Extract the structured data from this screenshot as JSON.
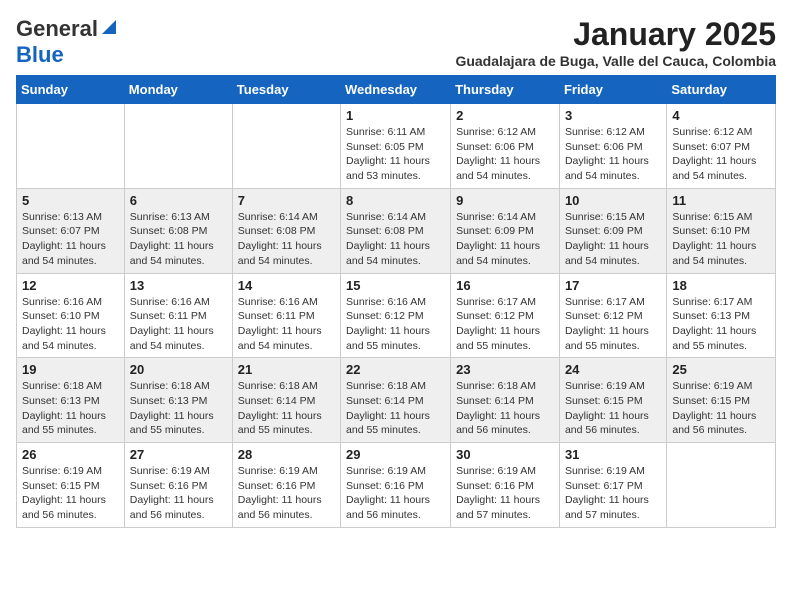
{
  "logo": {
    "general": "General",
    "blue": "Blue"
  },
  "header": {
    "month": "January 2025",
    "subtitle": "Guadalajara de Buga, Valle del Cauca, Colombia"
  },
  "weekdays": [
    "Sunday",
    "Monday",
    "Tuesday",
    "Wednesday",
    "Thursday",
    "Friday",
    "Saturday"
  ],
  "weeks": [
    [
      {
        "day": "",
        "info": ""
      },
      {
        "day": "",
        "info": ""
      },
      {
        "day": "",
        "info": ""
      },
      {
        "day": "1",
        "info": "Sunrise: 6:11 AM\nSunset: 6:05 PM\nDaylight: 11 hours\nand 53 minutes."
      },
      {
        "day": "2",
        "info": "Sunrise: 6:12 AM\nSunset: 6:06 PM\nDaylight: 11 hours\nand 54 minutes."
      },
      {
        "day": "3",
        "info": "Sunrise: 6:12 AM\nSunset: 6:06 PM\nDaylight: 11 hours\nand 54 minutes."
      },
      {
        "day": "4",
        "info": "Sunrise: 6:12 AM\nSunset: 6:07 PM\nDaylight: 11 hours\nand 54 minutes."
      }
    ],
    [
      {
        "day": "5",
        "info": "Sunrise: 6:13 AM\nSunset: 6:07 PM\nDaylight: 11 hours\nand 54 minutes."
      },
      {
        "day": "6",
        "info": "Sunrise: 6:13 AM\nSunset: 6:08 PM\nDaylight: 11 hours\nand 54 minutes."
      },
      {
        "day": "7",
        "info": "Sunrise: 6:14 AM\nSunset: 6:08 PM\nDaylight: 11 hours\nand 54 minutes."
      },
      {
        "day": "8",
        "info": "Sunrise: 6:14 AM\nSunset: 6:08 PM\nDaylight: 11 hours\nand 54 minutes."
      },
      {
        "day": "9",
        "info": "Sunrise: 6:14 AM\nSunset: 6:09 PM\nDaylight: 11 hours\nand 54 minutes."
      },
      {
        "day": "10",
        "info": "Sunrise: 6:15 AM\nSunset: 6:09 PM\nDaylight: 11 hours\nand 54 minutes."
      },
      {
        "day": "11",
        "info": "Sunrise: 6:15 AM\nSunset: 6:10 PM\nDaylight: 11 hours\nand 54 minutes."
      }
    ],
    [
      {
        "day": "12",
        "info": "Sunrise: 6:16 AM\nSunset: 6:10 PM\nDaylight: 11 hours\nand 54 minutes."
      },
      {
        "day": "13",
        "info": "Sunrise: 6:16 AM\nSunset: 6:11 PM\nDaylight: 11 hours\nand 54 minutes."
      },
      {
        "day": "14",
        "info": "Sunrise: 6:16 AM\nSunset: 6:11 PM\nDaylight: 11 hours\nand 54 minutes."
      },
      {
        "day": "15",
        "info": "Sunrise: 6:16 AM\nSunset: 6:12 PM\nDaylight: 11 hours\nand 55 minutes."
      },
      {
        "day": "16",
        "info": "Sunrise: 6:17 AM\nSunset: 6:12 PM\nDaylight: 11 hours\nand 55 minutes."
      },
      {
        "day": "17",
        "info": "Sunrise: 6:17 AM\nSunset: 6:12 PM\nDaylight: 11 hours\nand 55 minutes."
      },
      {
        "day": "18",
        "info": "Sunrise: 6:17 AM\nSunset: 6:13 PM\nDaylight: 11 hours\nand 55 minutes."
      }
    ],
    [
      {
        "day": "19",
        "info": "Sunrise: 6:18 AM\nSunset: 6:13 PM\nDaylight: 11 hours\nand 55 minutes."
      },
      {
        "day": "20",
        "info": "Sunrise: 6:18 AM\nSunset: 6:13 PM\nDaylight: 11 hours\nand 55 minutes."
      },
      {
        "day": "21",
        "info": "Sunrise: 6:18 AM\nSunset: 6:14 PM\nDaylight: 11 hours\nand 55 minutes."
      },
      {
        "day": "22",
        "info": "Sunrise: 6:18 AM\nSunset: 6:14 PM\nDaylight: 11 hours\nand 55 minutes."
      },
      {
        "day": "23",
        "info": "Sunrise: 6:18 AM\nSunset: 6:14 PM\nDaylight: 11 hours\nand 56 minutes."
      },
      {
        "day": "24",
        "info": "Sunrise: 6:19 AM\nSunset: 6:15 PM\nDaylight: 11 hours\nand 56 minutes."
      },
      {
        "day": "25",
        "info": "Sunrise: 6:19 AM\nSunset: 6:15 PM\nDaylight: 11 hours\nand 56 minutes."
      }
    ],
    [
      {
        "day": "26",
        "info": "Sunrise: 6:19 AM\nSunset: 6:15 PM\nDaylight: 11 hours\nand 56 minutes."
      },
      {
        "day": "27",
        "info": "Sunrise: 6:19 AM\nSunset: 6:16 PM\nDaylight: 11 hours\nand 56 minutes."
      },
      {
        "day": "28",
        "info": "Sunrise: 6:19 AM\nSunset: 6:16 PM\nDaylight: 11 hours\nand 56 minutes."
      },
      {
        "day": "29",
        "info": "Sunrise: 6:19 AM\nSunset: 6:16 PM\nDaylight: 11 hours\nand 56 minutes."
      },
      {
        "day": "30",
        "info": "Sunrise: 6:19 AM\nSunset: 6:16 PM\nDaylight: 11 hours\nand 57 minutes."
      },
      {
        "day": "31",
        "info": "Sunrise: 6:19 AM\nSunset: 6:17 PM\nDaylight: 11 hours\nand 57 minutes."
      },
      {
        "day": "",
        "info": ""
      }
    ]
  ]
}
